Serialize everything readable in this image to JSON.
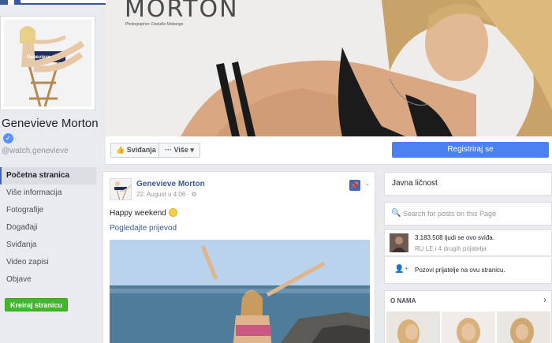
{
  "topbar": {
    "logo_icon": "facebook-logo-icon"
  },
  "profile": {
    "name": "Genevieve Morton",
    "handle": "@watch.genevieve",
    "verified_icon": "verified-badge-icon",
    "chair_text": "Genevieve"
  },
  "nav": {
    "items": [
      "Početna stranica",
      "Više informacija",
      "Fotografije",
      "Događaji",
      "Sviđanja",
      "Video zapisi",
      "Objave"
    ],
    "active_index": 0
  },
  "create_page_label": "Kreiraj stranicu",
  "cover": {
    "title": "MORTON",
    "credit": "Photographer: Danielle Mobange"
  },
  "actions": {
    "like_label": "Sviđanja",
    "more_label": "Više",
    "register_label": "Registriraj se"
  },
  "post": {
    "author": "Genevieve Morton",
    "meta": "22. August u 4:06 · ⚙",
    "text": "Happy weekend",
    "translate_label": "Pogledajte prijevod"
  },
  "right": {
    "category": "Javna ličnost",
    "search_placeholder": "Search for posts on this Page",
    "likes_count_text": "3.183.508 ljudi se ovo sviđa.",
    "likes_friends_text": "RU LE i 4 drugih prijatelja",
    "invite_text": "Pozovi prijatelje na ovu stranicu.",
    "about_header": "O NAMA"
  },
  "colors": {
    "facebook_blue": "#3b5998",
    "link_blue": "#365899",
    "register_blue": "#4a80f0",
    "create_green": "#42b72a"
  }
}
